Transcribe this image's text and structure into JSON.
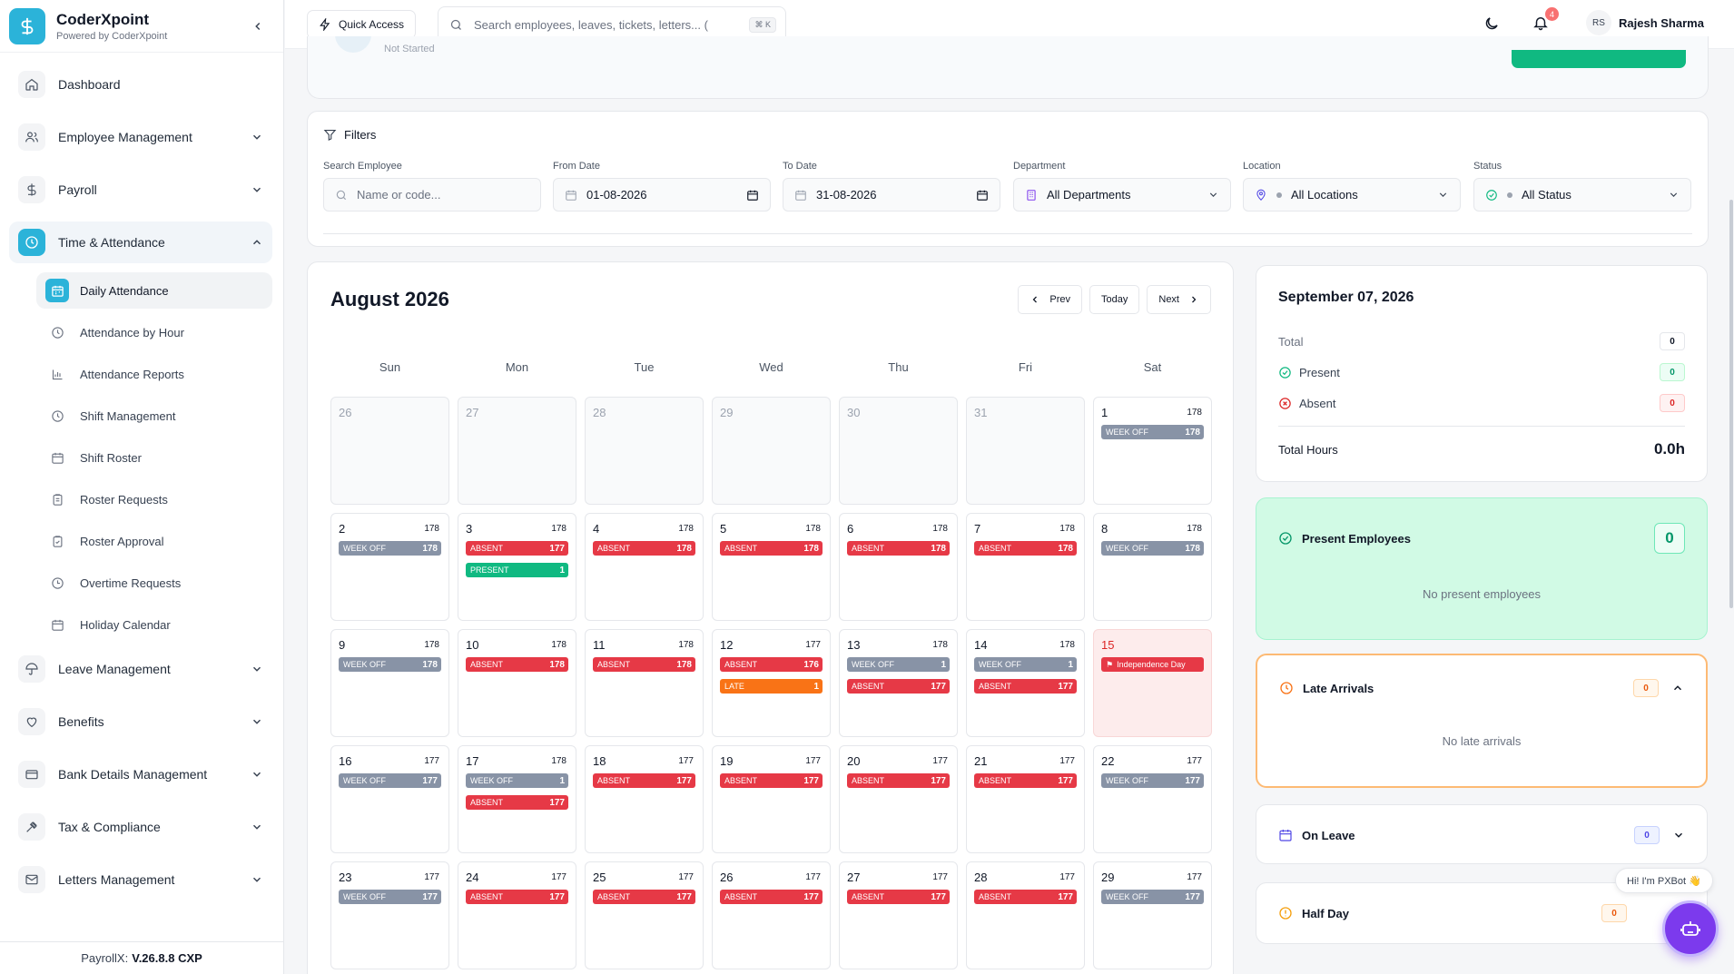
{
  "brand": {
    "name": "CoderXpoint",
    "sub": "Powered by CoderXpoint"
  },
  "nav": {
    "dashboard": "Dashboard",
    "employee_management": "Employee Management",
    "payroll": "Payroll",
    "time_attendance": "Time & Attendance",
    "leave_management": "Leave Management",
    "benefits": "Benefits",
    "bank_details": "Bank Details Management",
    "tax_compliance": "Tax & Compliance",
    "letters": "Letters Management"
  },
  "subnav": {
    "daily_attendance": "Daily Attendance",
    "attendance_by_hour": "Attendance by Hour",
    "attendance_reports": "Attendance Reports",
    "shift_management": "Shift Management",
    "shift_roster": "Shift Roster",
    "roster_requests": "Roster Requests",
    "roster_approval": "Roster Approval",
    "overtime_requests": "Overtime Requests",
    "holiday_calendar": "Holiday Calendar"
  },
  "footer": {
    "prefix": "PayrollX:",
    "version": "V.26.8.8 CXP"
  },
  "topbar": {
    "quick_access": "Quick Access",
    "search_placeholder": "Search employees, leaves, tickets, letters... (",
    "shortcut": "⌘ K",
    "notif_count": "4",
    "user_initials": "RS",
    "user_name": "Rajesh Sharma"
  },
  "strip": {
    "text": "Not Started"
  },
  "filters": {
    "title": "Filters",
    "search_label": "Search Employee",
    "search_placeholder": "Name or code...",
    "from_label": "From Date",
    "from_value": "01-08-2026",
    "to_label": "To Date",
    "to_value": "31-08-2026",
    "department_label": "Department",
    "department_value": "All Departments",
    "location_label": "Location",
    "location_value": "All Locations",
    "status_label": "Status",
    "status_value": "All Status"
  },
  "calendar": {
    "title": "August 2026",
    "prev": "Prev",
    "today": "Today",
    "next": "Next",
    "days_of_week": [
      "Sun",
      "Mon",
      "Tue",
      "Wed",
      "Thu",
      "Fri",
      "Sat"
    ],
    "days": [
      {
        "n": "26",
        "other": true,
        "cnt": "",
        "chips": []
      },
      {
        "n": "27",
        "other": true,
        "cnt": "",
        "chips": []
      },
      {
        "n": "28",
        "other": true,
        "cnt": "",
        "chips": []
      },
      {
        "n": "29",
        "other": true,
        "cnt": "",
        "chips": []
      },
      {
        "n": "30",
        "other": true,
        "cnt": "",
        "chips": []
      },
      {
        "n": "31",
        "other": true,
        "cnt": "",
        "chips": []
      },
      {
        "n": "1",
        "cnt": "178",
        "chips": [
          {
            "t": "weekoff",
            "l": "WEEK OFF",
            "c": "178"
          }
        ]
      },
      {
        "n": "2",
        "cnt": "178",
        "chips": [
          {
            "t": "weekoff",
            "l": "WEEK OFF",
            "c": "178"
          }
        ]
      },
      {
        "n": "3",
        "cnt": "178",
        "chips": [
          {
            "t": "absent",
            "l": "ABSENT",
            "c": "177"
          },
          {
            "t": "present",
            "l": "PRESENT",
            "c": "1"
          }
        ]
      },
      {
        "n": "4",
        "cnt": "178",
        "chips": [
          {
            "t": "absent",
            "l": "ABSENT",
            "c": "178"
          }
        ]
      },
      {
        "n": "5",
        "cnt": "178",
        "chips": [
          {
            "t": "absent",
            "l": "ABSENT",
            "c": "178"
          }
        ]
      },
      {
        "n": "6",
        "cnt": "178",
        "chips": [
          {
            "t": "absent",
            "l": "ABSENT",
            "c": "178"
          }
        ]
      },
      {
        "n": "7",
        "cnt": "178",
        "chips": [
          {
            "t": "absent",
            "l": "ABSENT",
            "c": "178"
          }
        ]
      },
      {
        "n": "8",
        "cnt": "178",
        "chips": [
          {
            "t": "weekoff",
            "l": "WEEK OFF",
            "c": "178"
          }
        ]
      },
      {
        "n": "9",
        "cnt": "178",
        "chips": [
          {
            "t": "weekoff",
            "l": "WEEK OFF",
            "c": "178"
          }
        ]
      },
      {
        "n": "10",
        "cnt": "178",
        "chips": [
          {
            "t": "absent",
            "l": "ABSENT",
            "c": "178"
          }
        ]
      },
      {
        "n": "11",
        "cnt": "178",
        "chips": [
          {
            "t": "absent",
            "l": "ABSENT",
            "c": "178"
          }
        ]
      },
      {
        "n": "12",
        "cnt": "177",
        "chips": [
          {
            "t": "absent",
            "l": "ABSENT",
            "c": "176"
          },
          {
            "t": "late",
            "l": "LATE",
            "c": "1"
          }
        ]
      },
      {
        "n": "13",
        "cnt": "178",
        "chips": [
          {
            "t": "weekoff",
            "l": "WEEK OFF",
            "c": "1"
          },
          {
            "t": "absent",
            "l": "ABSENT",
            "c": "177"
          }
        ]
      },
      {
        "n": "14",
        "cnt": "178",
        "chips": [
          {
            "t": "weekoff",
            "l": "WEEK OFF",
            "c": "1"
          },
          {
            "t": "absent",
            "l": "ABSENT",
            "c": "177"
          }
        ]
      },
      {
        "n": "15",
        "holiday": true,
        "cnt": "",
        "chips": [
          {
            "t": "holiday",
            "l": "Independence Day",
            "c": ""
          }
        ]
      },
      {
        "n": "16",
        "cnt": "177",
        "chips": [
          {
            "t": "weekoff",
            "l": "WEEK OFF",
            "c": "177"
          }
        ]
      },
      {
        "n": "17",
        "cnt": "178",
        "chips": [
          {
            "t": "weekoff",
            "l": "WEEK OFF",
            "c": "1"
          },
          {
            "t": "absent",
            "l": "ABSENT",
            "c": "177"
          }
        ]
      },
      {
        "n": "18",
        "cnt": "177",
        "chips": [
          {
            "t": "absent",
            "l": "ABSENT",
            "c": "177"
          }
        ]
      },
      {
        "n": "19",
        "cnt": "177",
        "chips": [
          {
            "t": "absent",
            "l": "ABSENT",
            "c": "177"
          }
        ]
      },
      {
        "n": "20",
        "cnt": "177",
        "chips": [
          {
            "t": "absent",
            "l": "ABSENT",
            "c": "177"
          }
        ]
      },
      {
        "n": "21",
        "cnt": "177",
        "chips": [
          {
            "t": "absent",
            "l": "ABSENT",
            "c": "177"
          }
        ]
      },
      {
        "n": "22",
        "cnt": "177",
        "chips": [
          {
            "t": "weekoff",
            "l": "WEEK OFF",
            "c": "177"
          }
        ]
      },
      {
        "n": "23",
        "cnt": "177",
        "chips": [
          {
            "t": "weekoff",
            "l": "WEEK OFF",
            "c": "177"
          }
        ]
      },
      {
        "n": "24",
        "cnt": "177",
        "chips": [
          {
            "t": "absent",
            "l": "ABSENT",
            "c": "177"
          }
        ]
      },
      {
        "n": "25",
        "cnt": "177",
        "chips": [
          {
            "t": "absent",
            "l": "ABSENT",
            "c": "177"
          }
        ]
      },
      {
        "n": "26",
        "cnt": "177",
        "chips": [
          {
            "t": "absent",
            "l": "ABSENT",
            "c": "177"
          }
        ]
      },
      {
        "n": "27",
        "cnt": "177",
        "chips": [
          {
            "t": "absent",
            "l": "ABSENT",
            "c": "177"
          }
        ]
      },
      {
        "n": "28",
        "cnt": "177",
        "chips": [
          {
            "t": "absent",
            "l": "ABSENT",
            "c": "177"
          }
        ]
      },
      {
        "n": "29",
        "cnt": "177",
        "chips": [
          {
            "t": "weekoff",
            "l": "WEEK OFF",
            "c": "177"
          }
        ]
      }
    ]
  },
  "summary": {
    "date": "September 07, 2026",
    "total_label": "Total",
    "total_value": "0",
    "present_label": "Present",
    "present_value": "0",
    "absent_label": "Absent",
    "absent_value": "0",
    "hours_label": "Total Hours",
    "hours_value": "0.0h"
  },
  "present_employees": {
    "title": "Present Employees",
    "count": "0",
    "empty": "No present employees"
  },
  "late_arrivals": {
    "title": "Late Arrivals",
    "count": "0",
    "empty": "No late arrivals"
  },
  "on_leave": {
    "title": "On Leave",
    "count": "0"
  },
  "half_day": {
    "title": "Half Day",
    "count": "0"
  },
  "bot": {
    "greeting": "Hi! I'm PXBot 👋"
  },
  "colors": {
    "accent": "#2bb3d9",
    "absent": "#e63946",
    "present": "#10b981",
    "late": "#f97316",
    "weekoff": "#8893a6",
    "bot": "#7c3aed"
  }
}
